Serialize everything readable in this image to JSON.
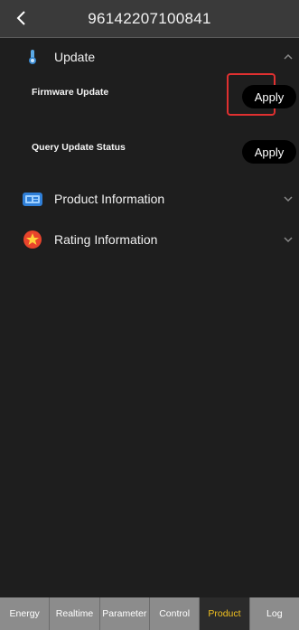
{
  "header": {
    "title": "96142207100841"
  },
  "update": {
    "label": "Update",
    "rows": [
      {
        "label": "Firmware Update",
        "button": "Apply"
      },
      {
        "label": "Query Update Status",
        "button": "Apply"
      }
    ]
  },
  "product_info": {
    "label": "Product Information"
  },
  "rating_info": {
    "label": "Rating Information"
  },
  "tabs": [
    "Energy",
    "Realtime",
    "Parameter",
    "Control",
    "Product",
    "Log"
  ],
  "active_tab": "Product",
  "colors": {
    "active_tab_text": "#f0c020",
    "highlight": "#e03030"
  }
}
